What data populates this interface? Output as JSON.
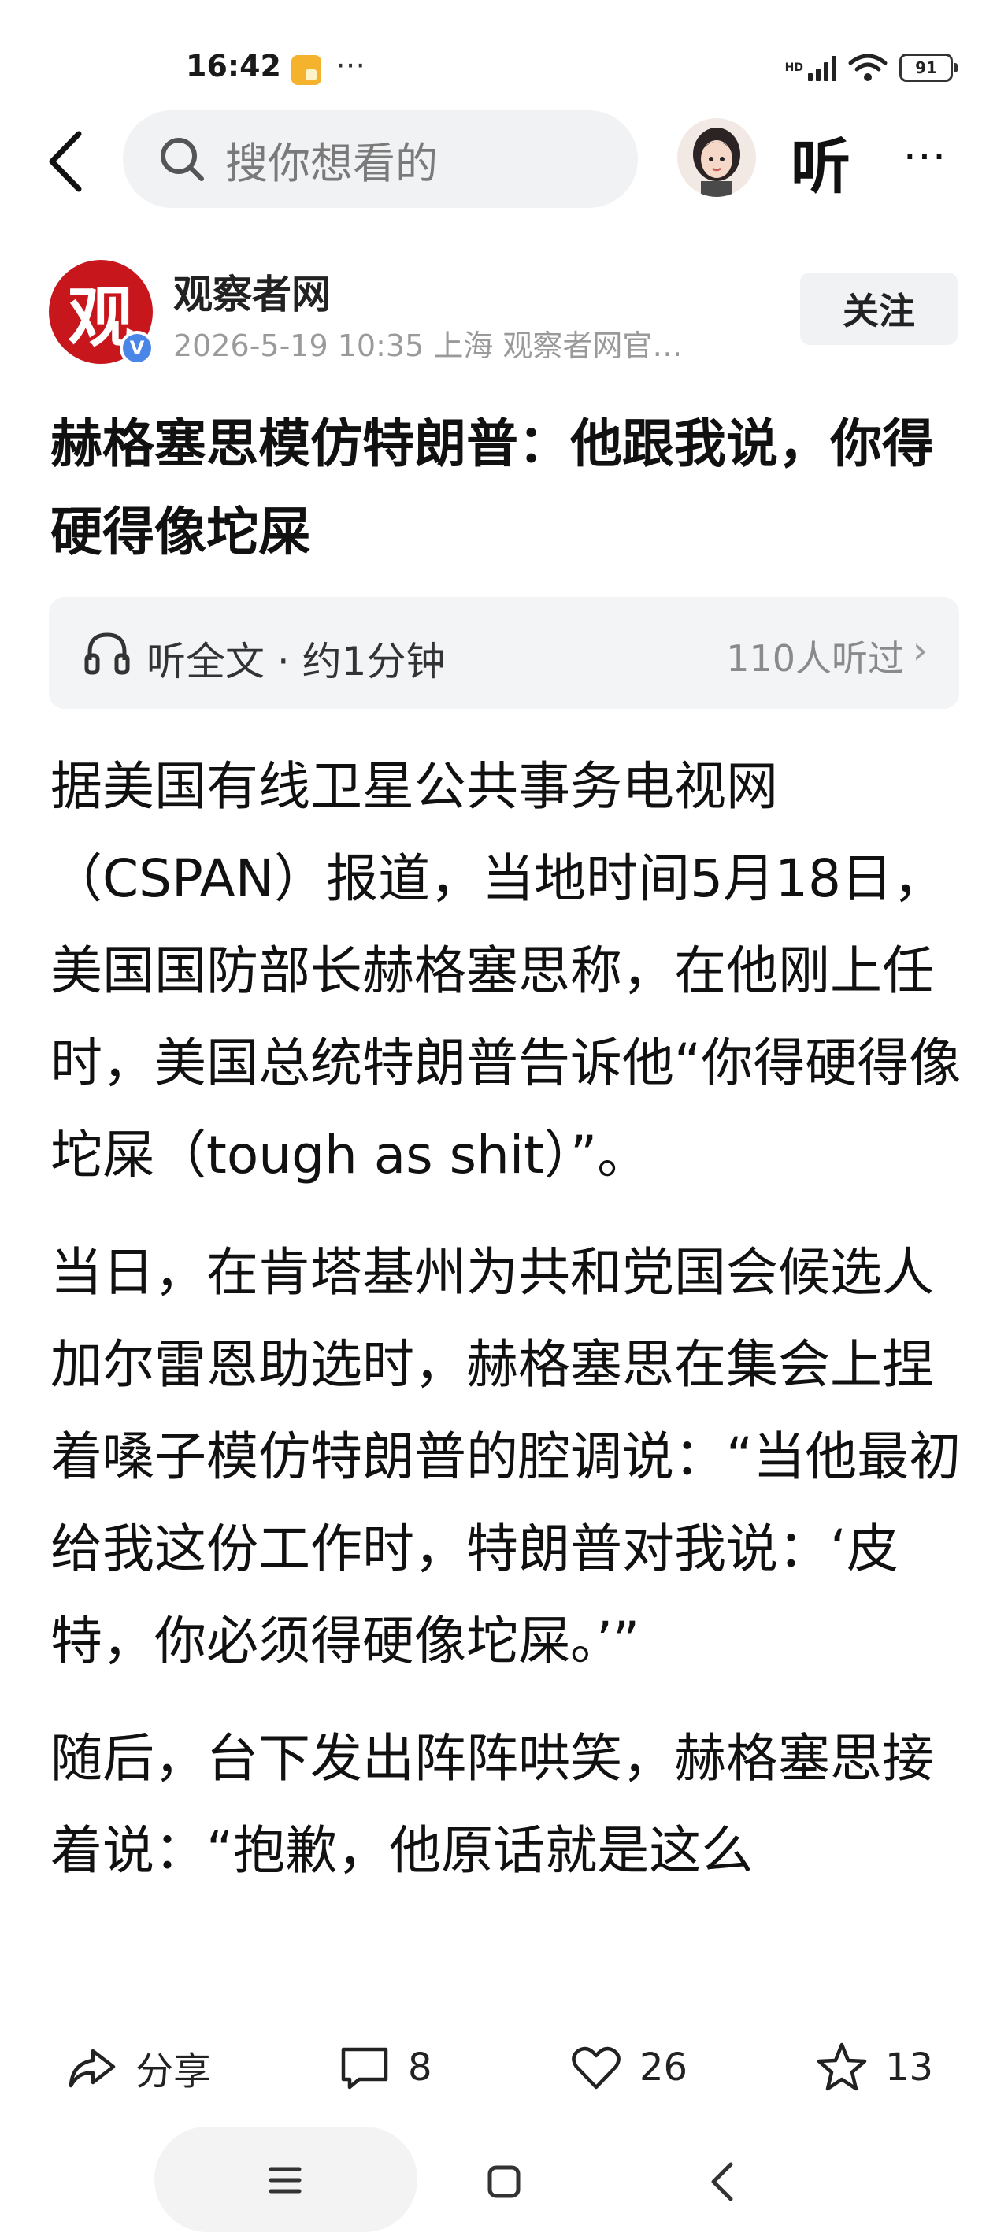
{
  "status_bar": {
    "time": "16:42",
    "more_icon": "⋯",
    "network": "HD",
    "battery": "91"
  },
  "top_nav": {
    "search_placeholder": "搜你想看的",
    "listen_label": "听",
    "more_label": "⋯"
  },
  "author": {
    "logo_text": "观",
    "name": "观察者网",
    "meta": "2026-5-19  10:35  上海  观察者网官…",
    "verified_badge": "V",
    "follow_label": "关注"
  },
  "article": {
    "title": "赫格塞思模仿特朗普：他跟我说，你得硬得像坨屎",
    "listen_bar": {
      "label": "听全文 · 约1分钟",
      "count": "110人听过",
      "chevron": "›"
    },
    "paragraphs": [
      "据美国有线卫星公共事务电视网（CSPAN）报道，当地时间5月18日，美国国防部长赫格塞思称，在他刚上任时，美国总统特朗普告诉他“你得硬得像坨屎（tough as shit）”。",
      "当日，在肯塔基州为共和党国会候选人加尔雷恩助选时，赫格塞思在集会上捏着嗓子模仿特朗普的腔调说：“当他最初给我这份工作时，特朗普对我说：‘皮特，你必须得硬像坨屎。’”",
      "随后，台下发出阵阵哄笑，赫格塞思接着说：“抱歉，他原话就是这么"
    ]
  },
  "actions": {
    "share_label": "分享",
    "comment_count": "8",
    "like_count": "26",
    "favorite_count": "13"
  },
  "colors": {
    "brand_red": "#c8161d",
    "verify_blue": "#4a86e8",
    "surface_gray": "#f1f2f4"
  },
  "icons": [
    "search-icon",
    "headphones-icon",
    "share-icon",
    "comment-icon",
    "heart-icon",
    "star-icon",
    "menu-icon",
    "home-icon",
    "back-icon"
  ]
}
